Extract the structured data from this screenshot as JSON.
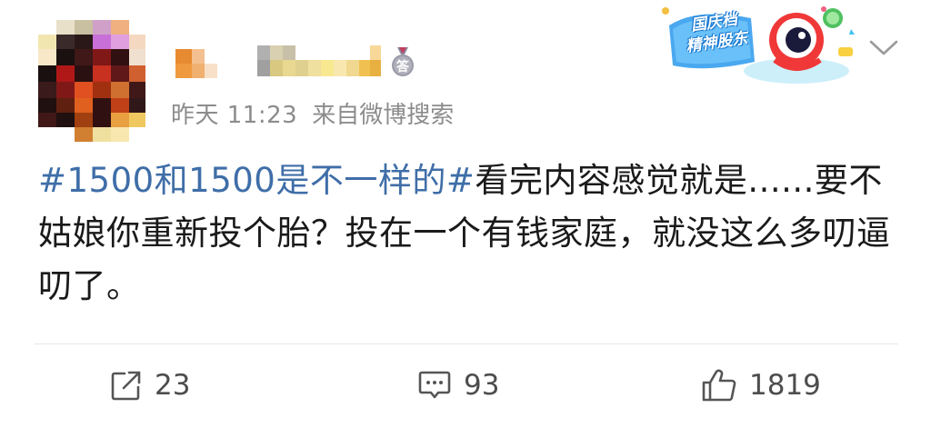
{
  "post": {
    "author": {
      "avatar": "pixelated-avatar",
      "username_obscured": true,
      "badge_icon": "medal-icon",
      "badge_text": "答"
    },
    "meta": {
      "time": "昨天 11:23",
      "source": "来自微博搜索"
    },
    "decoration": {
      "label_line1": "国庆档",
      "label_line2": "精神股东"
    },
    "menu_icon": "chevron-down-icon",
    "content": {
      "hashtag": "#1500和1500是不一样的#",
      "text": "看完内容感觉就是......要不姑娘你重新投个胎？投在一个有钱家庭，就没这么多叨逼叨了。"
    },
    "actions": {
      "repost": {
        "icon": "repost-icon",
        "count": "23"
      },
      "comment": {
        "icon": "comment-icon",
        "count": "93"
      },
      "like": {
        "icon": "thumbs-up-icon",
        "count": "1819"
      }
    }
  },
  "colors": {
    "hashtag": "#3f6ea8",
    "meta_text": "#8c8c8c",
    "body_text": "#1a1a1a",
    "action_text": "#4d4d4d",
    "divider": "#e6e6e6"
  }
}
